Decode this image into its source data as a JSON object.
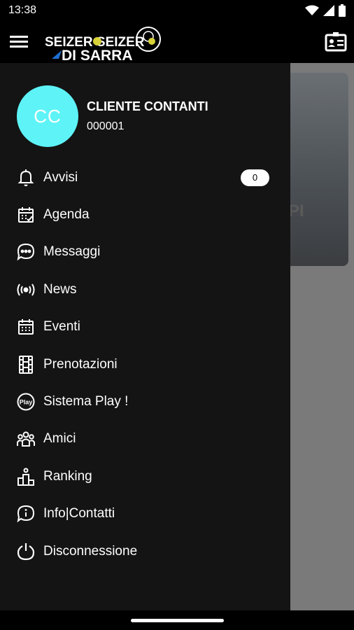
{
  "status_bar": {
    "time": "13:38",
    "icons": [
      "wifi-icon",
      "signal-icon",
      "battery-icon"
    ]
  },
  "app_bar": {
    "menu_icon": "hamburger-menu-icon",
    "logo_text_top": "SEIZER SEIZER",
    "logo_text_bottom": "DI SARRA",
    "card_icon": "contact-card-icon"
  },
  "background": {
    "card_text": "PI"
  },
  "drawer": {
    "avatar_initials": "CC",
    "avatar_color": "#5ef3f7",
    "user_name": "CLIENTE CONTANTI",
    "user_code": "000001",
    "items": [
      {
        "label": "Avvisi",
        "icon": "bell-icon",
        "badge": "0"
      },
      {
        "label": "Agenda",
        "icon": "calendar-check-icon"
      },
      {
        "label": "Messaggi",
        "icon": "chat-bubble-icon"
      },
      {
        "label": "News",
        "icon": "broadcast-icon"
      },
      {
        "label": "Eventi",
        "icon": "calendar-grid-icon"
      },
      {
        "label": "Prenotazioni",
        "icon": "film-strip-icon"
      },
      {
        "label": "Sistema Play !",
        "icon": "play-logo-icon"
      },
      {
        "label": "Amici",
        "icon": "group-icon"
      },
      {
        "label": "Ranking",
        "icon": "podium-icon"
      },
      {
        "label": "Info|Contatti",
        "icon": "info-bubble-icon"
      },
      {
        "label": "Disconnessione",
        "icon": "power-icon"
      }
    ]
  }
}
